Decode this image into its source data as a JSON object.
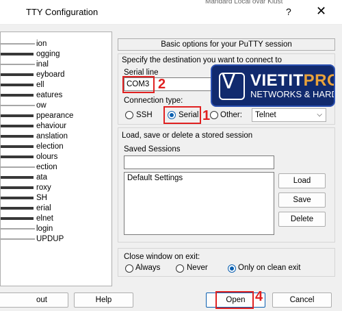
{
  "window": {
    "title": "TTY Configuration",
    "help_glyph": "?",
    "close_glyph": "✕",
    "background_text": "Mandard Local ovar Klust"
  },
  "tree": {
    "items": [
      {
        "label": "ion"
      },
      {
        "label": "ogging"
      },
      {
        "label": "inal"
      },
      {
        "label": "eyboard"
      },
      {
        "label": "ell"
      },
      {
        "label": "eatures"
      },
      {
        "label": "ow"
      },
      {
        "label": "ppearance"
      },
      {
        "label": "ehaviour"
      },
      {
        "label": "anslation"
      },
      {
        "label": "election"
      },
      {
        "label": "olours"
      },
      {
        "label": "ection"
      },
      {
        "label": "ata"
      },
      {
        "label": "roxy"
      },
      {
        "label": "SH"
      },
      {
        "label": "erial"
      },
      {
        "label": "elnet"
      },
      {
        "label": "login"
      },
      {
        "label": "UPDUP"
      }
    ]
  },
  "panel": {
    "header": "Basic options for your PuTTY session",
    "destination_label": "Specify the destination you want to connect to",
    "serial_line_label": "Serial line",
    "serial_line_value": "COM3",
    "connection_type_label": "Connection type:",
    "conn_types": {
      "ssh": "SSH",
      "serial": "Serial",
      "other": "Other:"
    },
    "other_select_value": "Telnet",
    "sessions_label": "Load, save or delete a stored session",
    "saved_sessions_label": "Saved Sessions",
    "saved_sessions_value": "",
    "sessions_list": [
      "Default Settings"
    ],
    "load_button": "Load",
    "save_button": "Save",
    "delete_button": "Delete",
    "close_window_label": "Close window on exit:",
    "close_options": {
      "always": "Always",
      "never": "Never",
      "clean": "Only on clean exit"
    }
  },
  "footer": {
    "about_button": "out",
    "help_button": "Help",
    "open_button": "Open",
    "cancel_button": "Cancel"
  },
  "annotations": {
    "n1": "1",
    "n2": "2",
    "n4": "4",
    "color": "#e02020"
  },
  "logo": {
    "name_main": "VIETIT",
    "name_accent": "PRO",
    "tagline": "NETWORKS & HARD",
    "mark": "V"
  }
}
